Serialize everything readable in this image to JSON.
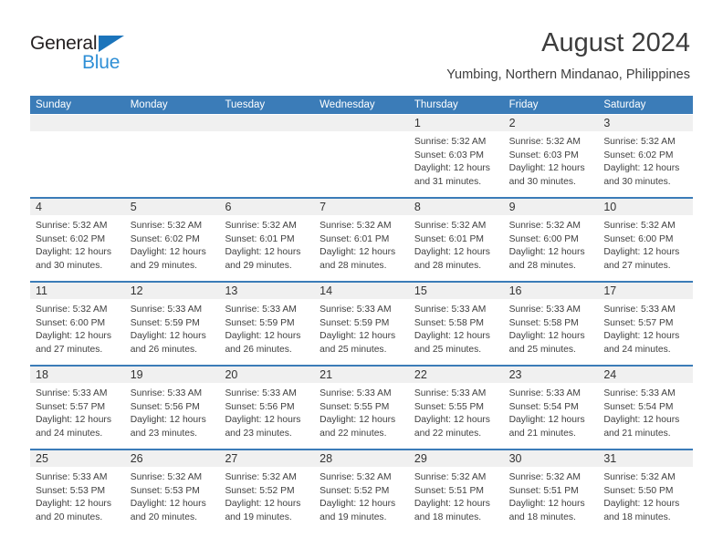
{
  "brand": {
    "name_part1": "General",
    "name_part2": "Blue",
    "triangle_color": "#1b74bb",
    "text_color": "#231f20",
    "accent_color": "#2f8fd6"
  },
  "header": {
    "title": "August 2024",
    "location": "Yumbing, Northern Mindanao, Philippines"
  },
  "theme": {
    "header_bar": "#3b7cb8",
    "day_band": "#f0f0f0",
    "text": "#404040"
  },
  "weekdays": [
    "Sunday",
    "Monday",
    "Tuesday",
    "Wednesday",
    "Thursday",
    "Friday",
    "Saturday"
  ],
  "weeks": [
    [
      {
        "day": "",
        "lines": []
      },
      {
        "day": "",
        "lines": []
      },
      {
        "day": "",
        "lines": []
      },
      {
        "day": "",
        "lines": []
      },
      {
        "day": "1",
        "lines": [
          "Sunrise: 5:32 AM",
          "Sunset: 6:03 PM",
          "Daylight: 12 hours",
          "and 31 minutes."
        ]
      },
      {
        "day": "2",
        "lines": [
          "Sunrise: 5:32 AM",
          "Sunset: 6:03 PM",
          "Daylight: 12 hours",
          "and 30 minutes."
        ]
      },
      {
        "day": "3",
        "lines": [
          "Sunrise: 5:32 AM",
          "Sunset: 6:02 PM",
          "Daylight: 12 hours",
          "and 30 minutes."
        ]
      }
    ],
    [
      {
        "day": "4",
        "lines": [
          "Sunrise: 5:32 AM",
          "Sunset: 6:02 PM",
          "Daylight: 12 hours",
          "and 30 minutes."
        ]
      },
      {
        "day": "5",
        "lines": [
          "Sunrise: 5:32 AM",
          "Sunset: 6:02 PM",
          "Daylight: 12 hours",
          "and 29 minutes."
        ]
      },
      {
        "day": "6",
        "lines": [
          "Sunrise: 5:32 AM",
          "Sunset: 6:01 PM",
          "Daylight: 12 hours",
          "and 29 minutes."
        ]
      },
      {
        "day": "7",
        "lines": [
          "Sunrise: 5:32 AM",
          "Sunset: 6:01 PM",
          "Daylight: 12 hours",
          "and 28 minutes."
        ]
      },
      {
        "day": "8",
        "lines": [
          "Sunrise: 5:32 AM",
          "Sunset: 6:01 PM",
          "Daylight: 12 hours",
          "and 28 minutes."
        ]
      },
      {
        "day": "9",
        "lines": [
          "Sunrise: 5:32 AM",
          "Sunset: 6:00 PM",
          "Daylight: 12 hours",
          "and 28 minutes."
        ]
      },
      {
        "day": "10",
        "lines": [
          "Sunrise: 5:32 AM",
          "Sunset: 6:00 PM",
          "Daylight: 12 hours",
          "and 27 minutes."
        ]
      }
    ],
    [
      {
        "day": "11",
        "lines": [
          "Sunrise: 5:32 AM",
          "Sunset: 6:00 PM",
          "Daylight: 12 hours",
          "and 27 minutes."
        ]
      },
      {
        "day": "12",
        "lines": [
          "Sunrise: 5:33 AM",
          "Sunset: 5:59 PM",
          "Daylight: 12 hours",
          "and 26 minutes."
        ]
      },
      {
        "day": "13",
        "lines": [
          "Sunrise: 5:33 AM",
          "Sunset: 5:59 PM",
          "Daylight: 12 hours",
          "and 26 minutes."
        ]
      },
      {
        "day": "14",
        "lines": [
          "Sunrise: 5:33 AM",
          "Sunset: 5:59 PM",
          "Daylight: 12 hours",
          "and 25 minutes."
        ]
      },
      {
        "day": "15",
        "lines": [
          "Sunrise: 5:33 AM",
          "Sunset: 5:58 PM",
          "Daylight: 12 hours",
          "and 25 minutes."
        ]
      },
      {
        "day": "16",
        "lines": [
          "Sunrise: 5:33 AM",
          "Sunset: 5:58 PM",
          "Daylight: 12 hours",
          "and 25 minutes."
        ]
      },
      {
        "day": "17",
        "lines": [
          "Sunrise: 5:33 AM",
          "Sunset: 5:57 PM",
          "Daylight: 12 hours",
          "and 24 minutes."
        ]
      }
    ],
    [
      {
        "day": "18",
        "lines": [
          "Sunrise: 5:33 AM",
          "Sunset: 5:57 PM",
          "Daylight: 12 hours",
          "and 24 minutes."
        ]
      },
      {
        "day": "19",
        "lines": [
          "Sunrise: 5:33 AM",
          "Sunset: 5:56 PM",
          "Daylight: 12 hours",
          "and 23 minutes."
        ]
      },
      {
        "day": "20",
        "lines": [
          "Sunrise: 5:33 AM",
          "Sunset: 5:56 PM",
          "Daylight: 12 hours",
          "and 23 minutes."
        ]
      },
      {
        "day": "21",
        "lines": [
          "Sunrise: 5:33 AM",
          "Sunset: 5:55 PM",
          "Daylight: 12 hours",
          "and 22 minutes."
        ]
      },
      {
        "day": "22",
        "lines": [
          "Sunrise: 5:33 AM",
          "Sunset: 5:55 PM",
          "Daylight: 12 hours",
          "and 22 minutes."
        ]
      },
      {
        "day": "23",
        "lines": [
          "Sunrise: 5:33 AM",
          "Sunset: 5:54 PM",
          "Daylight: 12 hours",
          "and 21 minutes."
        ]
      },
      {
        "day": "24",
        "lines": [
          "Sunrise: 5:33 AM",
          "Sunset: 5:54 PM",
          "Daylight: 12 hours",
          "and 21 minutes."
        ]
      }
    ],
    [
      {
        "day": "25",
        "lines": [
          "Sunrise: 5:33 AM",
          "Sunset: 5:53 PM",
          "Daylight: 12 hours",
          "and 20 minutes."
        ]
      },
      {
        "day": "26",
        "lines": [
          "Sunrise: 5:32 AM",
          "Sunset: 5:53 PM",
          "Daylight: 12 hours",
          "and 20 minutes."
        ]
      },
      {
        "day": "27",
        "lines": [
          "Sunrise: 5:32 AM",
          "Sunset: 5:52 PM",
          "Daylight: 12 hours",
          "and 19 minutes."
        ]
      },
      {
        "day": "28",
        "lines": [
          "Sunrise: 5:32 AM",
          "Sunset: 5:52 PM",
          "Daylight: 12 hours",
          "and 19 minutes."
        ]
      },
      {
        "day": "29",
        "lines": [
          "Sunrise: 5:32 AM",
          "Sunset: 5:51 PM",
          "Daylight: 12 hours",
          "and 18 minutes."
        ]
      },
      {
        "day": "30",
        "lines": [
          "Sunrise: 5:32 AM",
          "Sunset: 5:51 PM",
          "Daylight: 12 hours",
          "and 18 minutes."
        ]
      },
      {
        "day": "31",
        "lines": [
          "Sunrise: 5:32 AM",
          "Sunset: 5:50 PM",
          "Daylight: 12 hours",
          "and 18 minutes."
        ]
      }
    ]
  ]
}
